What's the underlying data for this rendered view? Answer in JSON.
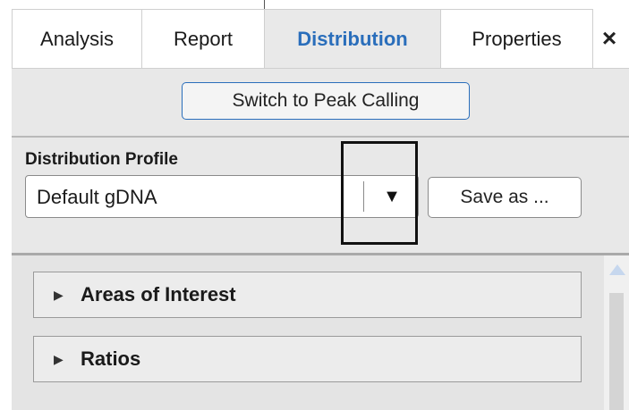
{
  "tabs": [
    {
      "label": "Analysis"
    },
    {
      "label": "Report"
    },
    {
      "label": "Distribution",
      "active": true
    },
    {
      "label": "Properties"
    }
  ],
  "close_icon": "×",
  "switch_button": "Switch to Peak Calling",
  "distribution_profile": {
    "label": "Distribution Profile",
    "selected_value": "Default gDNA",
    "dropdown_icon": "▼",
    "save_button": "Save as ..."
  },
  "sections": [
    {
      "label": "Areas of Interest",
      "expanded": false
    },
    {
      "label": "Ratios",
      "expanded": false
    }
  ],
  "colors": {
    "active_tab_text": "#2a6ebb",
    "switch_border": "#2a6ebb",
    "panel_background": "#e8e8e8"
  }
}
